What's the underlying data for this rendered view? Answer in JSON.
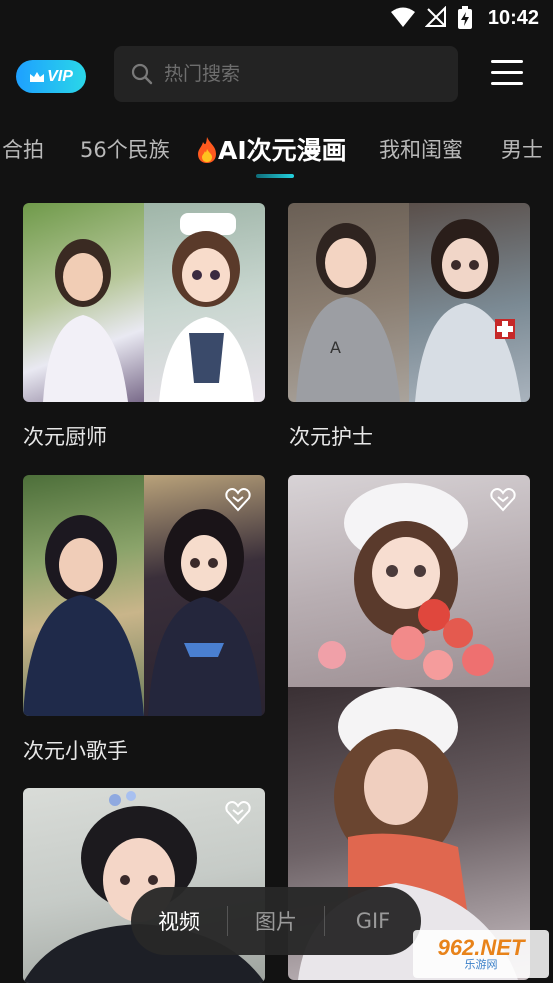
{
  "status_bar": {
    "time": "10:42"
  },
  "header": {
    "vip_label": "VIP",
    "search_placeholder": "热门搜索"
  },
  "tabs": [
    {
      "label": "合拍"
    },
    {
      "label": "56个民族"
    },
    {
      "label": "AI次元漫画",
      "active": true,
      "icon": "fire-icon"
    },
    {
      "label": "我和闺蜜"
    },
    {
      "label": "男士"
    }
  ],
  "cards": [
    {
      "caption": "次元厨师"
    },
    {
      "caption": "次元护士"
    },
    {
      "caption": "次元小歌手"
    },
    {
      "caption": ""
    },
    {
      "caption": ""
    }
  ],
  "bottom_switch": {
    "options": [
      "视频",
      "图片",
      "GIF"
    ],
    "selected": "视频"
  },
  "watermark": {
    "brand": "962.NET",
    "sub": "乐游网"
  },
  "colors": {
    "background": "#121212",
    "accent": "#23d2df",
    "vip": "#1ea0ff"
  }
}
